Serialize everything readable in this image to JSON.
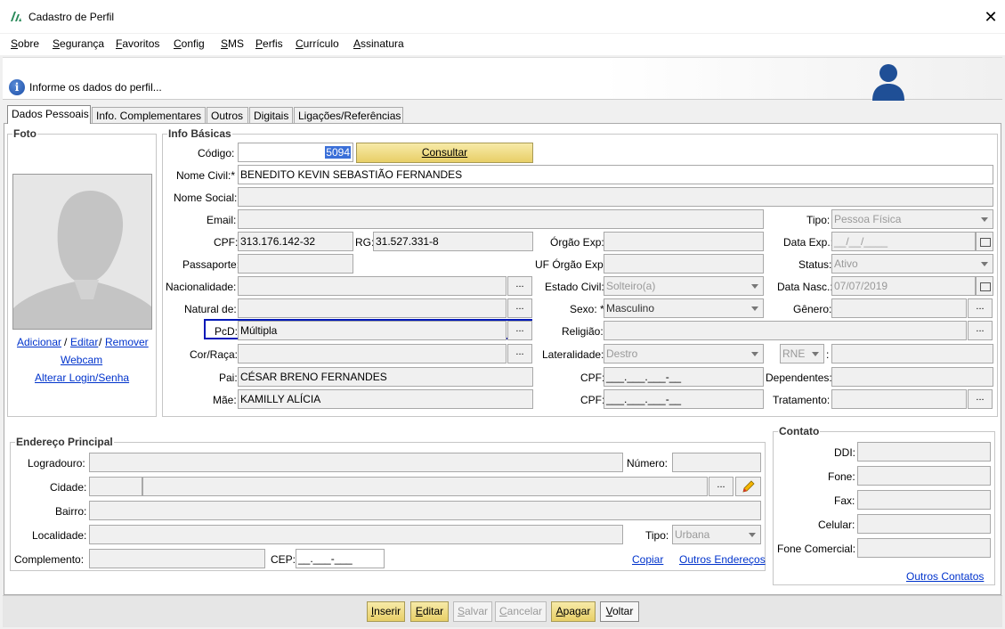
{
  "window": {
    "title": "Cadastro de Perfil",
    "close": "✕"
  },
  "menu": [
    {
      "label": "Sobre",
      "u": "S",
      "rest": "obre"
    },
    {
      "label": "Segurança",
      "u": "S",
      "rest": "egurança"
    },
    {
      "label": "Favoritos",
      "u": "F",
      "rest": "avoritos"
    },
    {
      "label": "Config",
      "u": "C",
      "rest": "onfig"
    },
    {
      "label": "SMS",
      "u": "S",
      "rest": "MS"
    },
    {
      "label": "Perfis",
      "u": "P",
      "rest": "erfis"
    },
    {
      "label": "Currículo",
      "u": "C",
      "rest": "urrículo"
    },
    {
      "label": "Assinatura",
      "u": "A",
      "rest": "ssinatura"
    }
  ],
  "header": {
    "info": "Informe os dados do perfil...",
    "info_icon": "i"
  },
  "tabs": [
    "Dados Pessoais",
    "Info. Complementares",
    "Outros",
    "Digitais",
    "Ligações/Referências"
  ],
  "foto": {
    "legend": "Foto",
    "adicionar": "Adicionar",
    "sep": "/",
    "editar": "Editar",
    "remover": "Remover",
    "webcam": "Webcam",
    "alterar_login": "Alterar Login/Senha"
  },
  "info": {
    "legend": "Info Básicas",
    "codigo_label": "Código:",
    "codigo": "5094",
    "consultar": "Consultar",
    "nome_civil_label": "Nome Civil:*",
    "nome_civil": "BENEDITO KEVIN SEBASTIÃO FERNANDES",
    "nome_social_label": "Nome Social:",
    "email_label": "Email:",
    "tipo_label": "Tipo:",
    "tipo": "Pessoa Física",
    "cpf_label": "CPF:",
    "cpf": "313.176.142-32",
    "rg_label": "RG:",
    "rg": "31.527.331-8",
    "orgao_exp_label": "Órgão Exp:",
    "data_exp_label": "Data Exp.:",
    "data_exp": "__/__/____",
    "passaporte_label": "Passaporte:",
    "uf_orgao_label": "UF Órgão Exp:",
    "status_label": "Status:",
    "status": "Ativo",
    "nacionalidade_label": "Nacionalidade:",
    "estado_civil_label": "Estado Civil:",
    "estado_civil": "Solteiro(a)",
    "data_nasc_label": "Data Nasc.:",
    "data_nasc": "07/07/2019",
    "natural_label": "Natural de:",
    "sexo_label": "Sexo: *",
    "sexo": "Masculino",
    "genero_label": "Gênero:",
    "pcd_label": "PcD:",
    "pcd": "Múltipla",
    "religiao_label": "Religião:",
    "cor_label": "Cor/Raça:",
    "lateralidade_label": "Lateralidade:",
    "lateralidade": "Destro",
    "rne": "RNE",
    "rne_colon": ":",
    "pai_label": "Pai:",
    "pai": "CÉSAR BRENO FERNANDES",
    "cpf_pai_label": "CPF:",
    "cpf_pai": "___.___.___-__",
    "dependentes_label": "Dependentes:",
    "mae_label": "Mãe:",
    "mae": "KAMILLY ALÍCIA",
    "cpf_mae_label": "CPF:",
    "cpf_mae": "___.___.___-__",
    "tratamento_label": "Tratamento:",
    "ellipsis": "..."
  },
  "endereco": {
    "legend": "Endereço Principal",
    "logradouro_label": "Logradouro:",
    "numero_label": "Número:",
    "cidade_label": "Cidade:",
    "bairro_label": "Bairro:",
    "localidade_label": "Localidade:",
    "tipo_label": "Tipo:",
    "tipo": "Urbana",
    "complemento_label": "Complemento:",
    "cep_label": "CEP:",
    "cep": "__.___-___",
    "copiar": "Copiar",
    "outros_enderecos": "Outros Endereços"
  },
  "contato": {
    "legend": "Contato",
    "ddi_label": "DDI:",
    "fone_label": "Fone:",
    "fax_label": "Fax:",
    "celular_label": "Celular:",
    "fone_comercial_label": "Fone Comercial:",
    "outros_contatos": "Outros Contatos"
  },
  "buttons": {
    "inserir": {
      "u": "I",
      "rest": "nserir"
    },
    "editar": {
      "u": "E",
      "rest": "ditar"
    },
    "salvar": {
      "u": "S",
      "rest": "alvar"
    },
    "cancelar": {
      "u": "C",
      "rest": "ancelar"
    },
    "apagar": {
      "u": "A",
      "rest": "pagar"
    },
    "voltar": {
      "u": "V",
      "rest": "oltar"
    }
  },
  "colors": {
    "accent_gold": "#e8cf67",
    "focus_border": "#0018b8",
    "link": "#0033cc",
    "selection": "#3a6fd8"
  }
}
